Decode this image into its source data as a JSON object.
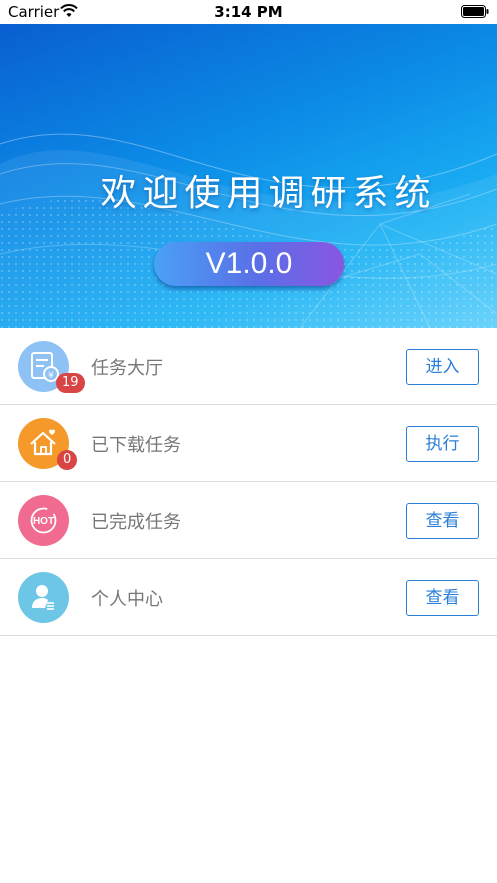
{
  "status_bar": {
    "carrier": "Carrier",
    "time": "3:14 PM"
  },
  "banner": {
    "title": "欢迎使用调研系统",
    "version": "V1.0.0"
  },
  "menu": {
    "items": [
      {
        "label": "任务大厅",
        "badge": "19",
        "button": "进入",
        "icon": "task-hall-icon",
        "color": "#8ec2f5"
      },
      {
        "label": "已下载任务",
        "badge": "0",
        "button": "执行",
        "icon": "house-icon",
        "color": "#f59a2a"
      },
      {
        "label": "已完成任务",
        "button": "查看",
        "icon": "hot-icon",
        "color": "#f06b8f"
      },
      {
        "label": "个人中心",
        "button": "查看",
        "icon": "user-icon",
        "color": "#6ec6e6"
      }
    ]
  },
  "colors": {
    "accent": "#2a7fd8",
    "badge": "#d94444",
    "divider": "#dddddd"
  }
}
